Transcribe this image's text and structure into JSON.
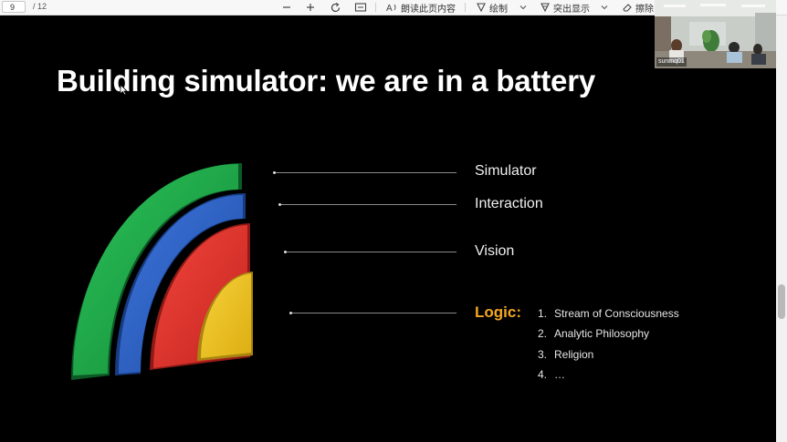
{
  "toolbar": {
    "page_current": "9",
    "page_total": "/ 12",
    "read_aloud_label": "朗读此页内容",
    "draw_label": "绘制",
    "highlight_label": "突出显示",
    "erase_label": "擦除"
  },
  "slide": {
    "title": "Building simulator: we are in a battery",
    "layers": {
      "simulator": "Simulator",
      "interaction": "Interaction",
      "vision": "Vision",
      "logic": "Logic:"
    },
    "logic_items": [
      {
        "num": "1.",
        "text": "Stream of Consciousness"
      },
      {
        "num": "2.",
        "text": "Analytic Philosophy"
      },
      {
        "num": "3.",
        "text": "Religion"
      },
      {
        "num": "4.",
        "text": "…"
      }
    ],
    "colors": {
      "simulator": "#1fa847",
      "interaction": "#2f63c8",
      "vision": "#e8342c",
      "logic": "#f2c21e",
      "logic_label": "#f4a623"
    }
  },
  "webcam": {
    "name": "sunmq01"
  }
}
